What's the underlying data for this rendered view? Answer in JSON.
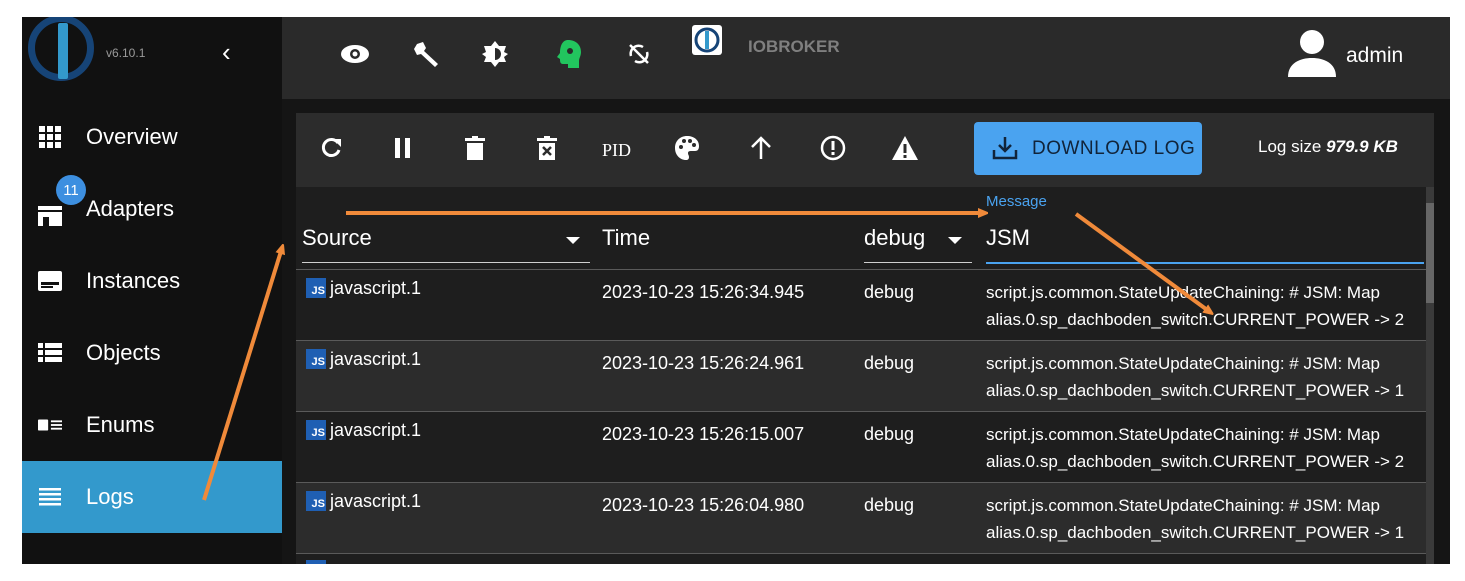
{
  "app": {
    "version": "v6.10.1",
    "brand": "IOBROKER",
    "user": "admin"
  },
  "sidebar": {
    "items": [
      {
        "label": "Overview",
        "icon": "grid-icon"
      },
      {
        "label": "Adapters",
        "icon": "store-icon",
        "badge": "11"
      },
      {
        "label": "Instances",
        "icon": "instances-icon"
      },
      {
        "label": "Objects",
        "icon": "list-icon"
      },
      {
        "label": "Enums",
        "icon": "enums-icon"
      },
      {
        "label": "Logs",
        "icon": "logs-icon",
        "active": true
      }
    ]
  },
  "topbar": {
    "icons": [
      "eye-icon",
      "wrench-icon",
      "brightness-icon",
      "expert-mode-icon",
      "sync-off-icon"
    ]
  },
  "toolbar": {
    "pid_label": "PID",
    "download_label": "DOWNLOAD LOG",
    "log_size_label": "Log size",
    "log_size_value": "979.9 KB"
  },
  "table": {
    "columns": {
      "source": "Source",
      "time": "Time",
      "level": "debug",
      "message_label": "Message",
      "message_filter": "JSM"
    },
    "rows": [
      {
        "source": "javascript.1",
        "time": "2023-10-23 15:26:34.945",
        "level": "debug",
        "msg1": "script.js.common.StateUpdateChaining: # JSM: Map",
        "msg2": "alias.0.sp_dachboden_switch.CURRENT_POWER -> 2"
      },
      {
        "source": "javascript.1",
        "time": "2023-10-23 15:26:24.961",
        "level": "debug",
        "msg1": "script.js.common.StateUpdateChaining: # JSM: Map",
        "msg2": "alias.0.sp_dachboden_switch.CURRENT_POWER -> 1"
      },
      {
        "source": "javascript.1",
        "time": "2023-10-23 15:26:15.007",
        "level": "debug",
        "msg1": "script.js.common.StateUpdateChaining: # JSM: Map",
        "msg2": "alias.0.sp_dachboden_switch.CURRENT_POWER -> 2"
      },
      {
        "source": "javascript.1",
        "time": "2023-10-23 15:26:04.980",
        "level": "debug",
        "msg1": "script.js.common.StateUpdateChaining: # JSM: Map",
        "msg2": "alias.0.sp_dachboden_switch.CURRENT_POWER -> 1"
      }
    ]
  },
  "colors": {
    "accent": "#3399cc",
    "download_button": "#4aa3f0",
    "annotation_arrow": "#f08a3a",
    "expert_icon": "#22c55e"
  }
}
